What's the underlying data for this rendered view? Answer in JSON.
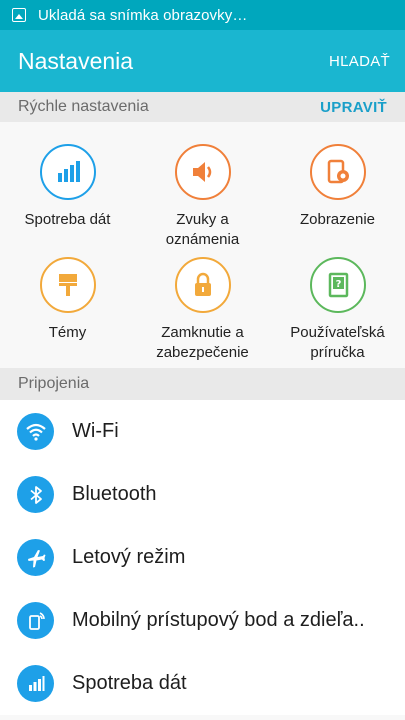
{
  "status_bar": {
    "text": "Ukladá sa snímka obrazovky…",
    "icon": "image-icon"
  },
  "app_bar": {
    "title": "Nastavenia",
    "search_label": "HĽADAŤ"
  },
  "quick_settings": {
    "header": "Rýchle nastavenia",
    "edit_label": "UPRAVIŤ",
    "tiles": [
      {
        "label": "Spotreba dát",
        "icon": "data-usage-icon",
        "color": "#1ea0e8"
      },
      {
        "label": "Zvuky a\noznámenia",
        "icon": "speaker-icon",
        "color": "#f0803a"
      },
      {
        "label": "Zobrazenie",
        "icon": "display-brightness-icon",
        "color": "#f0803a"
      },
      {
        "label": "Témy",
        "icon": "paint-brush-icon",
        "color": "#f2a93b"
      },
      {
        "label": "Zamknutie a\nzabezpečenie",
        "icon": "lock-icon",
        "color": "#f2a93b"
      },
      {
        "label": "Používateľská\npríručka",
        "icon": "help-book-icon",
        "color": "#5cb85c"
      }
    ]
  },
  "connections": {
    "header": "Pripojenia",
    "items": [
      {
        "label": "Wi-Fi",
        "icon": "wifi-icon"
      },
      {
        "label": "Bluetooth",
        "icon": "bluetooth-icon"
      },
      {
        "label": "Letový režim",
        "icon": "airplane-icon"
      },
      {
        "label": "Mobilný prístupový bod a zdieľa..",
        "icon": "hotspot-icon"
      },
      {
        "label": "Spotreba dát",
        "icon": "data-usage-icon"
      }
    ]
  },
  "colors": {
    "accent": "#1ab6d0",
    "status_bar": "#00a7bd",
    "list_icon": "#1ea0e8",
    "link": "#1a9fc9"
  }
}
